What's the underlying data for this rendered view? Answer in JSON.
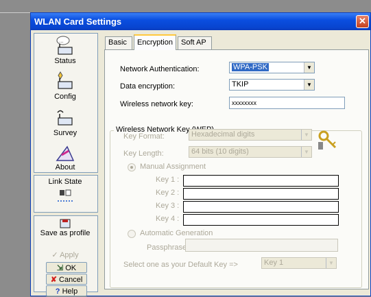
{
  "window": {
    "title": "WLAN Card Settings",
    "close_glyph": "✕"
  },
  "sidebar": {
    "items": [
      {
        "label": "Status",
        "icon": "status-icon"
      },
      {
        "label": "Config",
        "icon": "config-icon"
      },
      {
        "label": "Survey",
        "icon": "survey-icon"
      },
      {
        "label": "About",
        "icon": "about-icon"
      }
    ],
    "link_state": {
      "label": "Link State",
      "icon": "link-state-icon"
    },
    "save_profile": {
      "label": "Save as profile",
      "icon": "save-profile-icon"
    },
    "apply": {
      "label": "Apply"
    },
    "ok": {
      "label": "OK"
    },
    "cancel": {
      "label": "Cancel"
    },
    "help": {
      "label": "Help"
    }
  },
  "tabs": [
    {
      "label": "Basic"
    },
    {
      "label": "Encryption",
      "active": true
    },
    {
      "label": "Soft AP"
    }
  ],
  "encryption": {
    "network_auth": {
      "label": "Network Authentication:",
      "value": "WPA-PSK"
    },
    "data_encryption": {
      "label": "Data encryption:",
      "value": "TKIP"
    },
    "network_key": {
      "label": "Wireless network key:",
      "value": "xxxxxxxx"
    }
  },
  "wep": {
    "title": "Wireless Network Key (WEP)",
    "key_format": {
      "label": "Key Format:",
      "value": "Hexadecimal digits"
    },
    "key_length": {
      "label": "Key Length:",
      "value": "64 bits (10 digits)"
    },
    "manual": {
      "label": "Manual Assignment"
    },
    "keys": [
      {
        "label": "Key 1 :",
        "value": ""
      },
      {
        "label": "Key 2 :",
        "value": ""
      },
      {
        "label": "Key 3 :",
        "value": ""
      },
      {
        "label": "Key 4 :",
        "value": ""
      }
    ],
    "automatic": {
      "label": "Automatic Generation"
    },
    "passphrase": {
      "label": "Passphrase :",
      "value": ""
    },
    "default_key": {
      "label": "Select one as your Default Key =>",
      "value": "Key 1"
    }
  },
  "colors": {
    "title_bar": "#0a4fe0",
    "selection": "#316ac5",
    "disabled_text": "#aca899"
  }
}
